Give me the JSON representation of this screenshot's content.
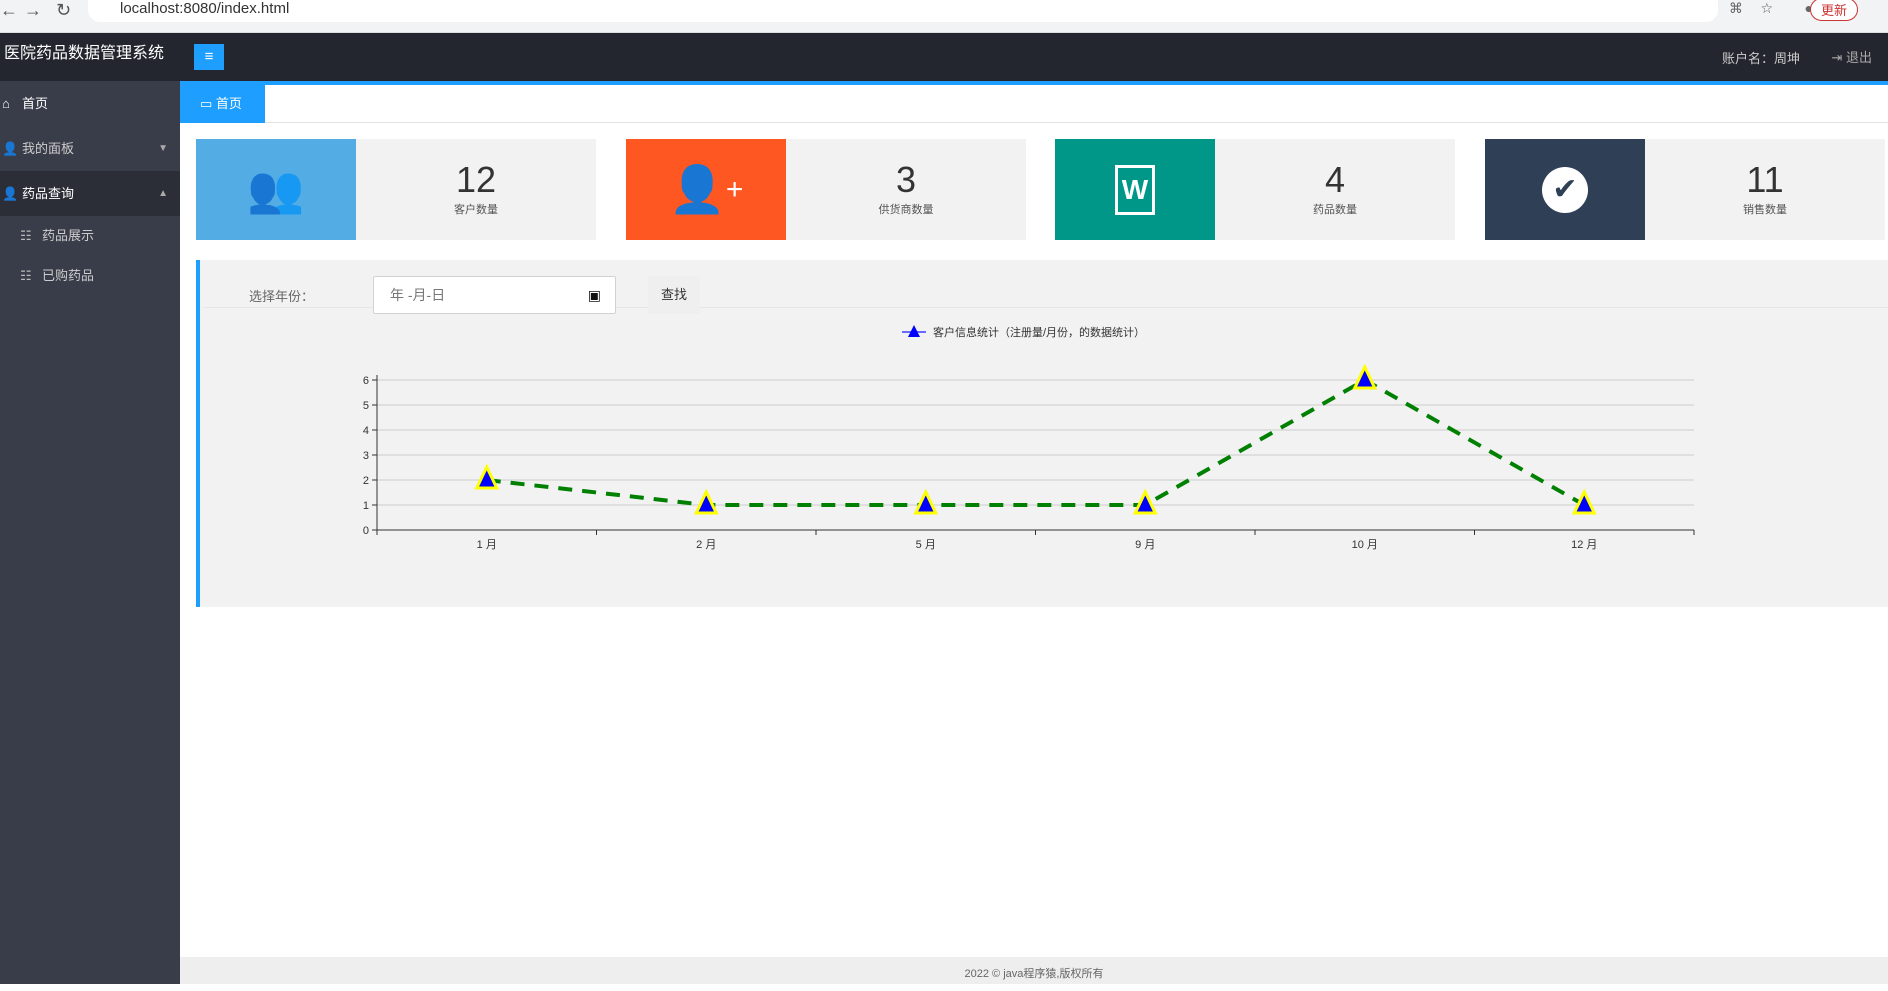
{
  "browser": {
    "url": "localhost:8080/index.html",
    "update_label": "更新"
  },
  "header": {
    "title": "医院药品数据管理系统",
    "menu_icon": "≡",
    "account_label": "账户名：周坤",
    "logout_label": "退出"
  },
  "sidebar": {
    "items": [
      {
        "label": "首页",
        "icon": "home"
      },
      {
        "label": "我的面板",
        "icon": "user"
      },
      {
        "label": "药品查询",
        "icon": "user"
      },
      {
        "label": "药品展示",
        "icon": "list"
      },
      {
        "label": "已购药品",
        "icon": "list"
      }
    ]
  },
  "tab": {
    "label": "首页"
  },
  "cards": [
    {
      "value": "12",
      "label": "客户数量",
      "color": "#53ace4",
      "icon": "users"
    },
    {
      "value": "3",
      "label": "供货商数量",
      "color": "#ff5722",
      "icon": "user-plus"
    },
    {
      "value": "4",
      "label": "药品数量",
      "color": "#009688",
      "icon": "word-file"
    },
    {
      "value": "11",
      "label": "销售数量",
      "color": "#2f4056",
      "icon": "check-circle"
    }
  ],
  "search": {
    "label": "选择年份：",
    "placeholder": "年 -月-日",
    "button": "查找"
  },
  "chart_data": {
    "type": "line",
    "legend": "客户信息统计（注册量/月份，的数据统计）",
    "legend_position": "top-center",
    "categories": [
      "1 月",
      "2 月",
      "5 月",
      "9 月",
      "10 月",
      "12 月"
    ],
    "values": [
      2,
      1,
      1,
      1,
      6,
      1
    ],
    "yticks": [
      "0",
      "1",
      "2",
      "3",
      "4",
      "5",
      "6"
    ],
    "ylim": [
      0,
      6
    ],
    "line_color": "#008000",
    "marker_color": "#0000ff",
    "marker_border": "#ffff00"
  },
  "footer": {
    "text": "2022 © java程序猿,版权所有"
  }
}
